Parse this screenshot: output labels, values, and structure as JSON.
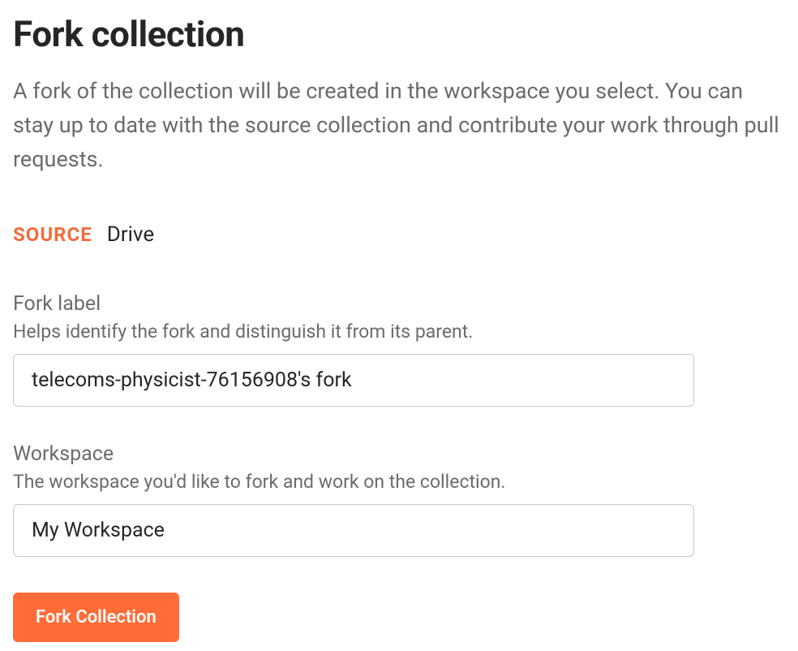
{
  "page": {
    "title": "Fork collection",
    "description": "A fork of the collection will be created in the workspace you select. You can stay up to date with the source collection and contribute your work through pull requests."
  },
  "source": {
    "label": "SOURCE",
    "value": "Drive"
  },
  "forkLabel": {
    "label": "Fork label",
    "help": "Helps identify the fork and distinguish it from its parent.",
    "value": "telecoms-physicist-76156908's fork"
  },
  "workspace": {
    "label": "Workspace",
    "help": "The workspace you'd like to fork and work on the collection.",
    "selected": "My Workspace"
  },
  "actions": {
    "forkButton": "Fork Collection"
  }
}
